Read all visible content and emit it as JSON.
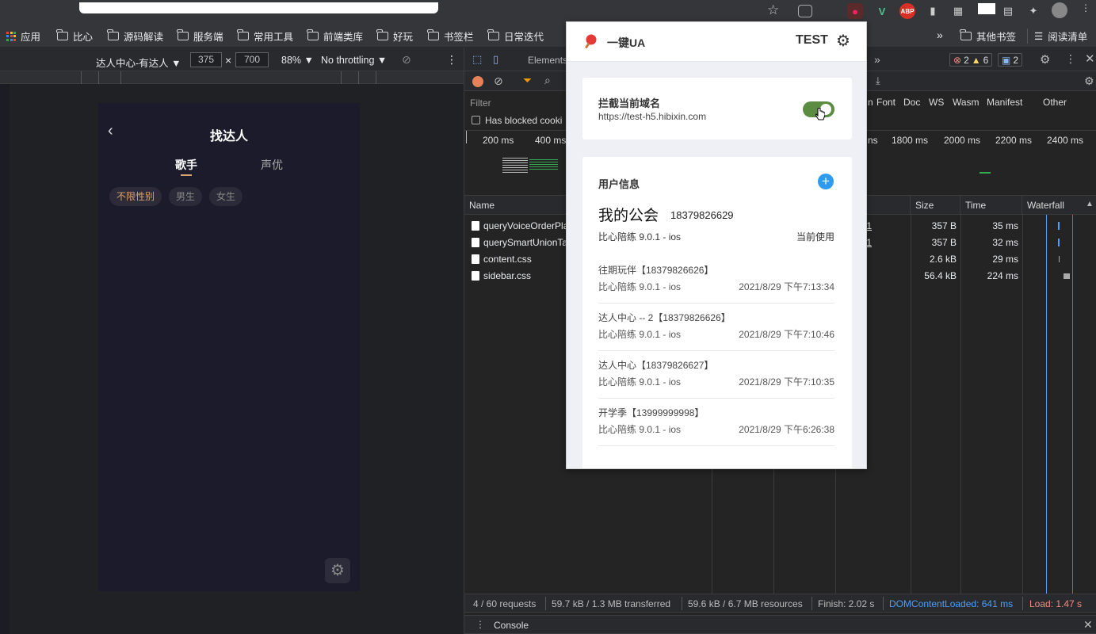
{
  "browser": {
    "bookmarks": [
      "应用",
      "比心",
      "源码解读",
      "服务端",
      "常用工具",
      "前端类库",
      "好玩",
      "书签栏",
      "日常迭代"
    ],
    "more": "»",
    "other_bookmarks": "其他书签",
    "reading_list": "阅读清单"
  },
  "device_toolbar": {
    "device": "达人中心-有达人 ▼",
    "width": "375",
    "x": "×",
    "height": "700",
    "zoom": "88% ▼",
    "throttle": "No throttling ▼"
  },
  "phone": {
    "title": "找达人",
    "tabs": [
      "歌手",
      "声优"
    ],
    "chips": [
      "不限性别",
      "男生",
      "女生"
    ]
  },
  "devtools": {
    "tab_elements": "Elements",
    "chevron": "»",
    "errors": "2",
    "warnings": "6",
    "messages": "2",
    "filter_placeholder": "Filter",
    "has_blocked": "Has blocked cooki",
    "type_filters": [
      "Font",
      "Doc",
      "WS",
      "Wasm",
      "Manifest",
      "Other"
    ],
    "type_filter_cut": "n",
    "timeline_left": [
      "200 ms",
      "400 ms"
    ],
    "timeline_right_cut": "ns",
    "timeline_right": [
      "1800 ms",
      "2000 ms",
      "2200 ms",
      "2400 ms"
    ],
    "columns": {
      "name": "Name",
      "initiator_cut": "r",
      "size": "Size",
      "time": "Time",
      "waterfall": "Waterfall"
    },
    "rows": [
      {
        "name": "queryVoiceOrderPla",
        "init": "s:1",
        "size": "357 B",
        "time": "35 ms"
      },
      {
        "name": "querySmartUnionTa",
        "init": "s:1",
        "size": "357 B",
        "time": "32 ms"
      },
      {
        "name": "content.css",
        "init": "",
        "size": "2.6 kB",
        "time": "29 ms"
      },
      {
        "name": "sidebar.css",
        "init": "",
        "size": "56.4 kB",
        "time": "224 ms"
      }
    ],
    "status": {
      "requests": "4 / 60 requests",
      "transferred": "59.7 kB / 1.3 MB transferred",
      "resources": "59.6 kB / 6.7 MB resources",
      "finish": "Finish: 2.02 s",
      "dcl": "DOMContentLoaded: 641 ms",
      "load": "Load: 1.47 s"
    },
    "console": "Console"
  },
  "popup": {
    "title": "一键UA",
    "env": "TEST",
    "intercept_label": "拦截当前域名",
    "intercept_url": "https://test-h5.hibixin.com",
    "intercept_on": true,
    "user_info": "用户信息",
    "current": {
      "name": "我的公会",
      "phone": "18379826629",
      "app": "比心陪练 9.0.1 - ios",
      "status": "当前使用"
    },
    "history": [
      {
        "title": "往期玩伴【18379826626】",
        "app": "比心陪练 9.0.1 - ios",
        "time": "2021/8/29 下午7:13:34"
      },
      {
        "title": "达人中心 -- 2【18379826626】",
        "app": "比心陪练 9.0.1 - ios",
        "time": "2021/8/29 下午7:10:46"
      },
      {
        "title": "达人中心【18379826627】",
        "app": "比心陪练 9.0.1 - ios",
        "time": "2021/8/29 下午7:10:35"
      },
      {
        "title": "开学季【13999999998】",
        "app": "比心陪练 9.0.1 - ios",
        "time": "2021/8/29 下午6:26:38"
      }
    ]
  },
  "colors": {
    "accent_blue": "#2f9bf0",
    "toggle_green": "#5b8c42",
    "chip_active": "#d8a373",
    "error_red": "#f28b82",
    "dcl_blue": "#4c9ffe"
  }
}
